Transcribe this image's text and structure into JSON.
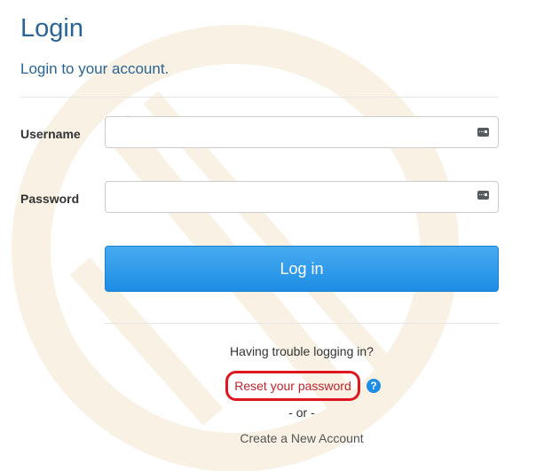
{
  "header": {
    "title": "Login",
    "subtitle": "Login to your account."
  },
  "form": {
    "username_label": "Username",
    "username_value": "",
    "password_label": "Password",
    "password_value": "",
    "login_button": "Log in"
  },
  "help": {
    "trouble_text": "Having trouble logging in?",
    "reset_link": "Reset your password",
    "help_icon_glyph": "?",
    "separator": "- or -",
    "create_account_link": "Create a New Account"
  },
  "colors": {
    "title": "#2a6496",
    "button": "#1e8de4",
    "reset_highlight": "#e0161e",
    "help_icon": "#1f8ce6",
    "watermark": "#f7efe0"
  },
  "icons": {
    "username_field_icon": "keyboard-icon",
    "password_field_icon": "keyboard-icon",
    "help": "question-circle-icon",
    "background": "logo-watermark"
  }
}
